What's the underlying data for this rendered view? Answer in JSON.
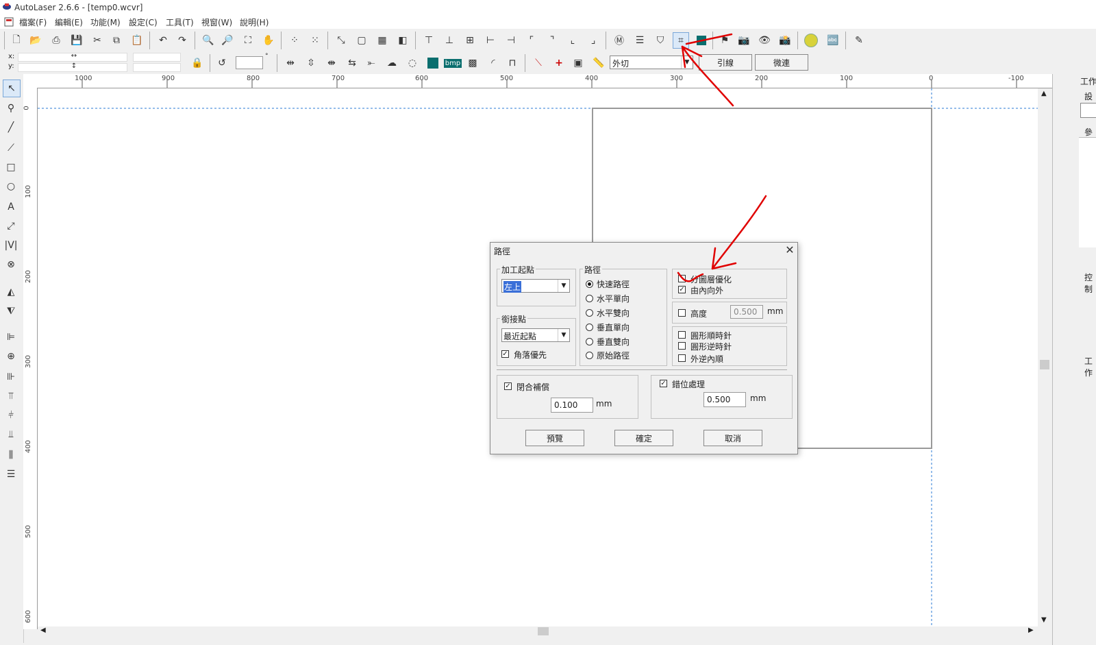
{
  "window": {
    "title": "AutoLaser 2.6.6 - [temp0.wcvr]"
  },
  "menu": [
    "檔案(F)",
    "編輯(E)",
    "功能(M)",
    "設定(C)",
    "工具(T)",
    "視窗(W)",
    "說明(H)"
  ],
  "toolbar2": {
    "x_label": "x:",
    "y_label": "y:",
    "layer_value": "外切",
    "lead_button": "引線",
    "micro_button": "微連",
    "bmp_label": "bmp",
    "angle_unit": "°"
  },
  "ruler": {
    "unit": "mm",
    "top_ticks": [
      "1000",
      "900",
      "800",
      "700",
      "600",
      "500",
      "400",
      "300",
      "200",
      "100",
      "0",
      "-100"
    ],
    "left_ticks": [
      "0",
      "100",
      "200",
      "300",
      "400",
      "500",
      "600"
    ]
  },
  "right_panel": {
    "labels": [
      "工作",
      "設備",
      "參數",
      "控制",
      "工作"
    ]
  },
  "dialog": {
    "title": "路徑",
    "group_start": {
      "label": "加工起點",
      "value": "左上"
    },
    "group_join": {
      "label": "銜接點",
      "value": "最近起點",
      "corner_first": "角落優先",
      "corner_first_checked": true
    },
    "group_path": {
      "label": "路徑",
      "options": [
        "快速路徑",
        "水平單向",
        "水平雙向",
        "垂直單向",
        "垂直雙向",
        "原始路徑"
      ],
      "selected": 0
    },
    "group_options": {
      "layer_opt": "分圖層優化",
      "layer_opt_checked": false,
      "inside_out": "由內向外",
      "inside_out_checked": true,
      "height_label": "高度",
      "height_checked": false,
      "height_value": "0.500",
      "height_unit": "mm",
      "circle_cw": "圓形順時針",
      "circle_ccw": "圓形逆時針",
      "outer_inner": "外逆內順"
    },
    "group_close": {
      "label": "閉合補償",
      "checked": true,
      "value": "0.100",
      "unit": "mm"
    },
    "group_offset": {
      "label": "錯位處理",
      "checked": true,
      "value": "0.500",
      "unit": "mm"
    },
    "buttons": {
      "preview": "預覽",
      "ok": "確定",
      "cancel": "取消"
    }
  },
  "colors": {
    "annotation": "#e00000",
    "guide": "#2a7ad5"
  }
}
